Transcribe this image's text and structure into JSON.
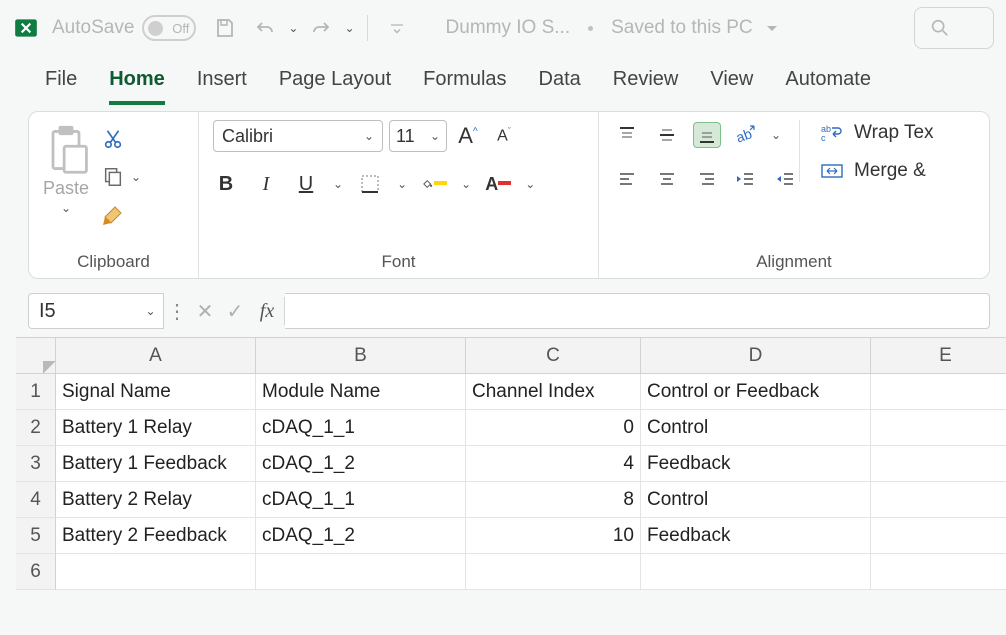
{
  "titlebar": {
    "autosave_label": "AutoSave",
    "autosave_state": "Off",
    "doc_short": "Dummy IO S...",
    "saved_state": "Saved to this PC"
  },
  "tabs": [
    "File",
    "Home",
    "Insert",
    "Page Layout",
    "Formulas",
    "Data",
    "Review",
    "View",
    "Automate"
  ],
  "active_tab": "Home",
  "ribbon": {
    "clipboard": {
      "paste": "Paste",
      "group": "Clipboard"
    },
    "font": {
      "name": "Calibri",
      "size": "11",
      "bold": "B",
      "italic": "I",
      "underline": "U",
      "group": "Font"
    },
    "alignment": {
      "wrap": "Wrap Tex",
      "merge": "Merge &",
      "group": "Alignment"
    }
  },
  "formula_bar": {
    "name_box": "I5",
    "fx": "fx",
    "formula": ""
  },
  "grid": {
    "columns": [
      "A",
      "B",
      "C",
      "D",
      "E"
    ],
    "row_labels": [
      "1",
      "2",
      "3",
      "4",
      "5",
      "6"
    ],
    "headers": [
      "Signal Name",
      "Module Name",
      "Channel Index",
      "Control or Feedback"
    ],
    "rows": [
      {
        "signal": "Battery 1 Relay",
        "module": "cDAQ_1_1",
        "index": "0",
        "cf": "Control"
      },
      {
        "signal": "Battery 1 Feedback",
        "module": "cDAQ_1_2",
        "index": "4",
        "cf": "Feedback"
      },
      {
        "signal": "Battery 2 Relay",
        "module": "cDAQ_1_1",
        "index": "8",
        "cf": "Control"
      },
      {
        "signal": "Battery 2 Feedback",
        "module": "cDAQ_1_2",
        "index": "10",
        "cf": "Feedback"
      }
    ]
  }
}
